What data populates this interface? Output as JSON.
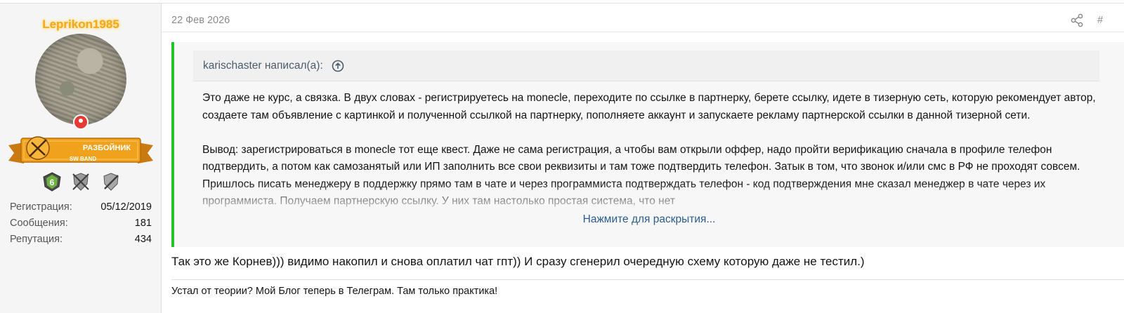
{
  "user": {
    "username": "Leprikon1985",
    "rank_title": "РАЗБОЙНИК",
    "rank_subtitle": "SW BAND",
    "badge_level": "6",
    "stats": [
      {
        "label": "Регистрация:",
        "value": "05/12/2019"
      },
      {
        "label": "Сообщения:",
        "value": "181"
      },
      {
        "label": "Репутация:",
        "value": "434"
      }
    ],
    "username_color": "#f5a623",
    "online_color": "#e53935",
    "avatar_icon": "user-avatar-photo"
  },
  "post": {
    "date": "22 Фев 2026",
    "hash": "#",
    "share_icon": "share-icon",
    "quote": {
      "author_line": "karischaster написал(а):",
      "paragraphs": [
        "Это даже не курс, а связка. В двух словах - регистрируетесь на monecle, переходите по ссылке в партнерку, берете ссылку, идете в тизерную сеть, которую рекомендует автор, создаете там объявление с картинкой и полученной ссылкой на партнерку, пополняете аккаунт и запускаете рекламу партнерской ссылки в данной тизерной сети.",
        "Вывод: зарегистрироваться в monecle тот еще квест. Даже не сама регистрация, а чтобы вам открыли оффер, надо пройти верификацию сначала в профиле телефон подтвердить, а потом как самозанятый или ИП заполнить все свои реквизиты и там тоже подтвердить телефон. Затык в том, что звонок и/или смс в РФ не проходят совсем. Пришлось писать менеджеру в поддержку прямо там в чате и через программиста подтверждать телефон - код подтверждения мне сказал менеджер в чате через их программиста. Получаем партнерскую ссылку. У них там настолько простая система, что нет"
      ],
      "expand_label": "Нажмите для раскрытия...",
      "accent_color": "#22c32e"
    },
    "reply_text": "Так это же Корнев))) видимо накопил и снова оплатил чат гпт)) И сразу сгенерил очередную схему которую даже не тестил.)",
    "signature": "Устал от теории? Мой Блог теперь в Телеграм. Там только практика!"
  }
}
